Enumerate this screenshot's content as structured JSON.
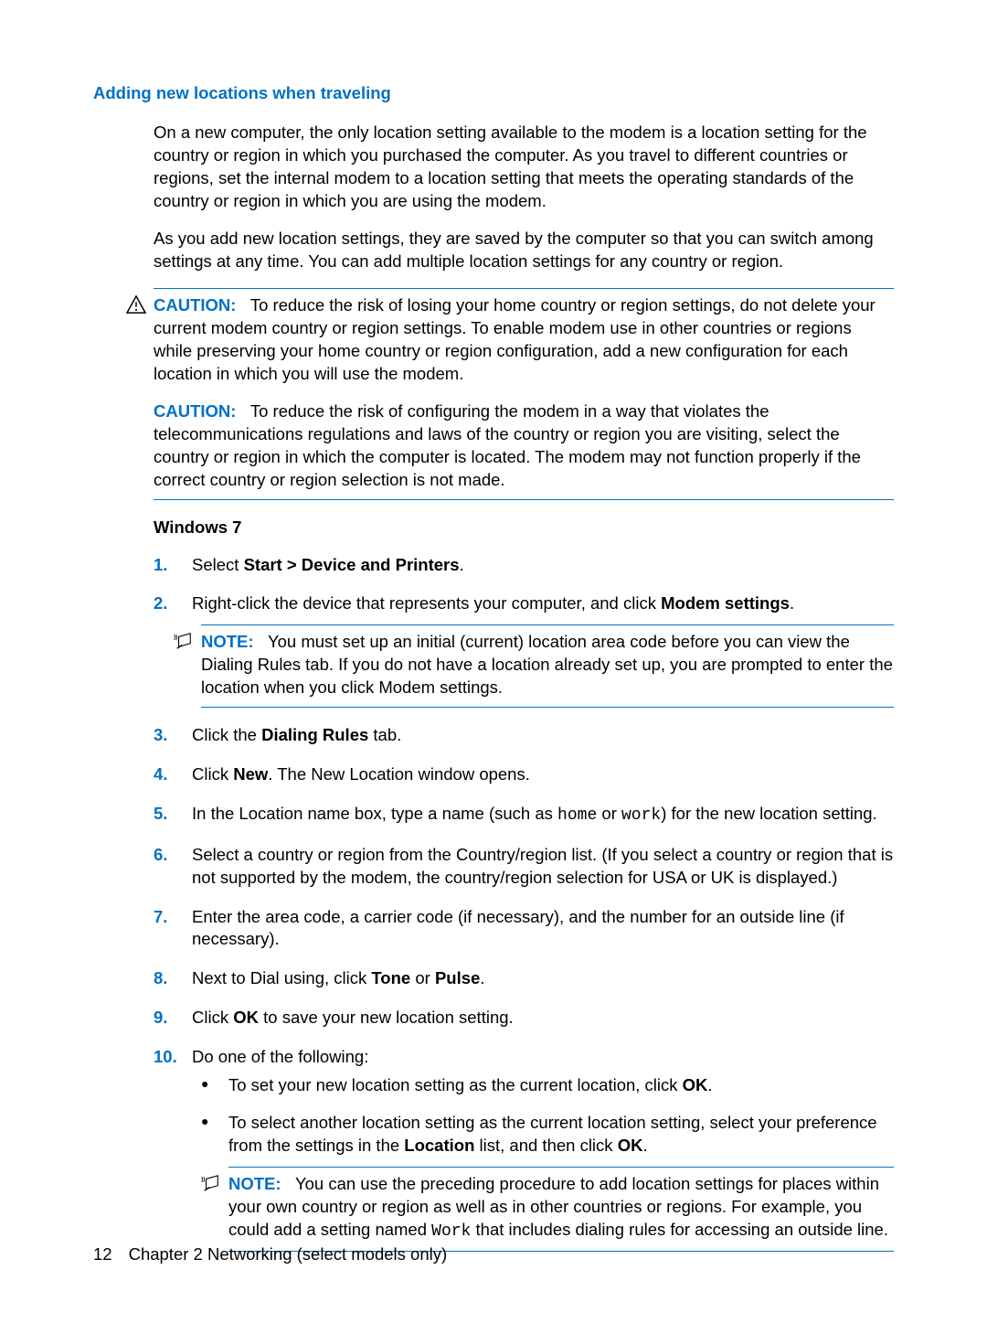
{
  "heading": "Adding new locations when traveling",
  "intro1": "On a new computer, the only location setting available to the modem is a location setting for the country or region in which you purchased the computer. As you travel to different countries or regions, set the internal modem to a location setting that meets the operating standards of the country or region in which you are using the modem.",
  "intro2": "As you add new location settings, they are saved by the computer so that you can switch among settings at any time. You can add multiple location settings for any country or region.",
  "caution_label": "CAUTION:",
  "caution1": "To reduce the risk of losing your home country or region settings, do not delete your current modem country or region settings. To enable modem use in other countries or regions while preserving your home country or region configuration, add a new configuration for each location in which you will use the modem.",
  "caution2": "To reduce the risk of configuring the modem in a way that violates the telecommunications regulations and laws of the country or region you are visiting, select the country or region in which the computer is located. The modem may not function properly if the correct country or region selection is not made.",
  "win7_heading": "Windows 7",
  "steps": {
    "s1_a": "Select ",
    "s1_b": "Start > Device and Printers",
    "s1_c": ".",
    "s2_a": "Right-click the device that represents your computer, and click ",
    "s2_b": "Modem settings",
    "s2_c": ".",
    "note_label": "NOTE:",
    "note1": "You must set up an initial (current) location area code before you can view the Dialing Rules tab. If you do not have a location already set up, you are prompted to enter the location when you click Modem settings.",
    "s3_a": "Click the ",
    "s3_b": "Dialing Rules",
    "s3_c": " tab.",
    "s4_a": "Click ",
    "s4_b": "New",
    "s4_c": ". The New Location window opens.",
    "s5_a": "In the Location name box, type a name (such as ",
    "s5_home": "home",
    "s5_b": " or ",
    "s5_work": "work",
    "s5_c": ") for the new location setting.",
    "s6": "Select a country or region from the Country/region list. (If you select a country or region that is not supported by the modem, the country/region selection for USA or UK is displayed.)",
    "s7": "Enter the area code, a carrier code (if necessary), and the number for an outside line (if necessary).",
    "s8_a": "Next to Dial using, click ",
    "s8_b": "Tone",
    "s8_c": " or ",
    "s8_d": "Pulse",
    "s8_e": ".",
    "s9_a": "Click ",
    "s9_b": "OK",
    "s9_c": " to save your new location setting.",
    "s10": "Do one of the following:",
    "b1_a": "To set your new location setting as the current location, click ",
    "b1_b": "OK",
    "b1_c": ".",
    "b2_a": "To select another location setting as the current location setting, select your preference from the settings in the ",
    "b2_b": "Location",
    "b2_c": " list, and then click ",
    "b2_d": "OK",
    "b2_e": ".",
    "note2_a": "You can use the preceding procedure to add location settings for places within your own country or region as well as in other countries or regions. For example, you could add a setting named ",
    "note2_work": "Work",
    "note2_b": " that includes dialing rules for accessing an outside line."
  },
  "footer": {
    "page": "12",
    "chapter": "Chapter 2   Networking (select models only)"
  }
}
